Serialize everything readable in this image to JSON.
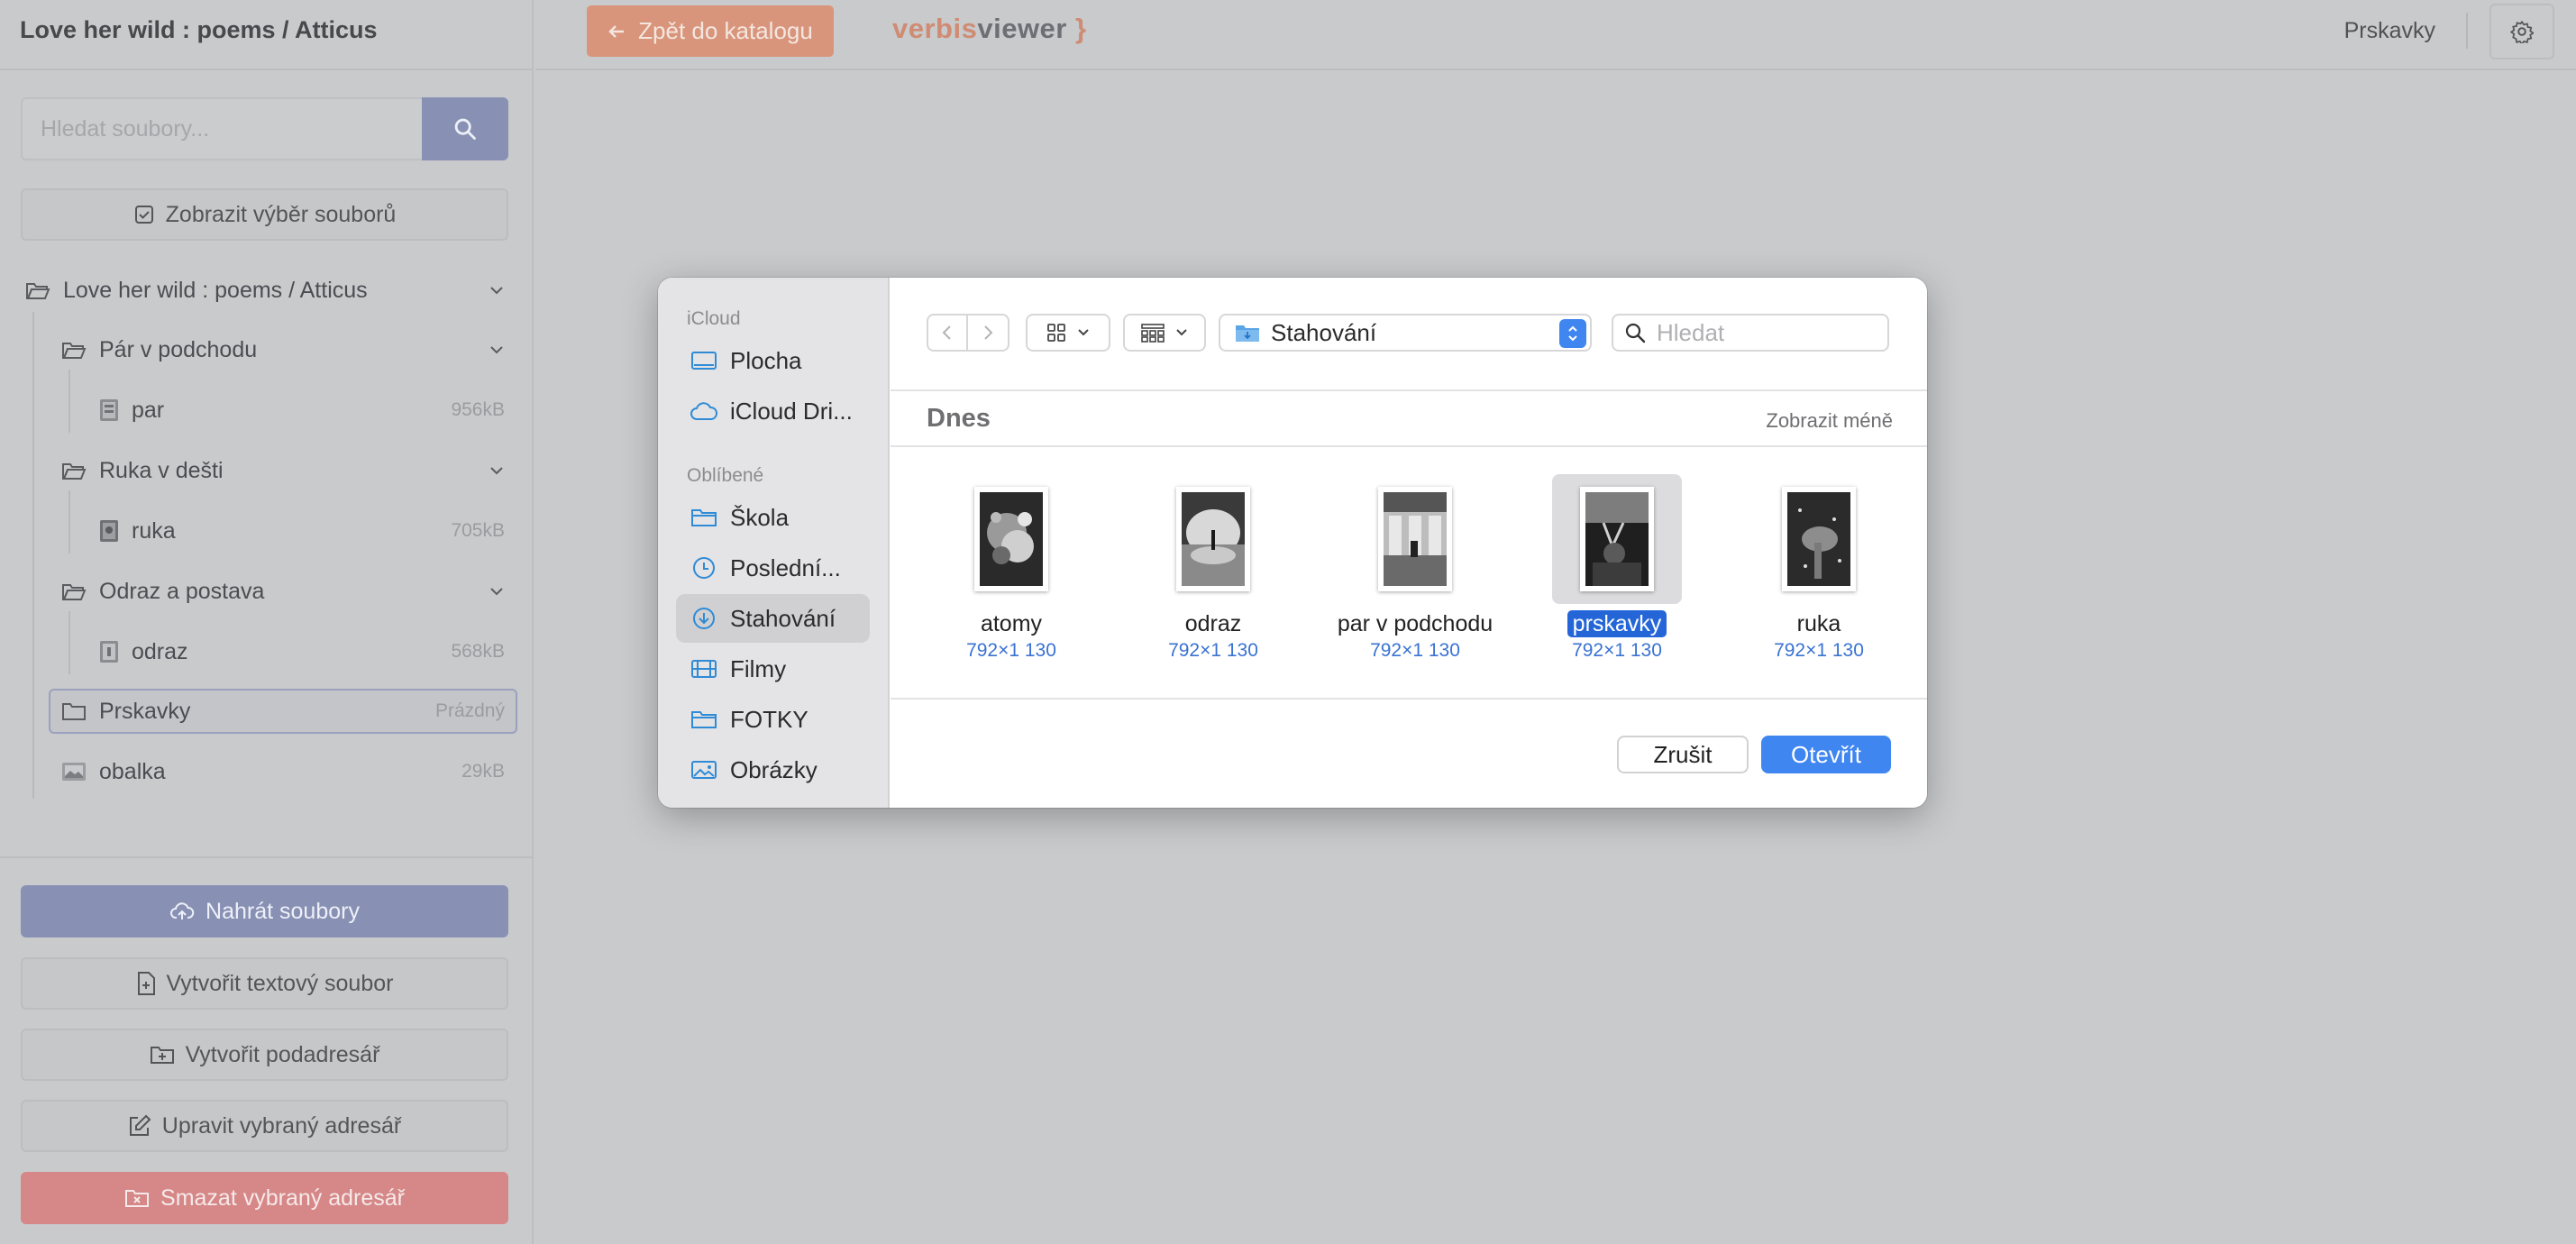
{
  "app": {
    "project_title": "Love her wild : poems / Atticus",
    "back_button": "Zpět do katalogu",
    "logo": {
      "part1": "verbis",
      "part2": "viewer",
      "part3": "}"
    },
    "user": "Prskavky",
    "icons": {
      "settings": "gear-icon",
      "back": "arrow-left-icon"
    }
  },
  "sidebar": {
    "search": {
      "placeholder": "Hledat soubory..."
    },
    "show_selection": "Zobrazit výběr souborů",
    "tree": {
      "root": "Love her wild : poems / Atticus",
      "folders": [
        {
          "label": "Pár v podchodu",
          "file": {
            "name": "par",
            "size": "956kB"
          }
        },
        {
          "label": "Ruka v dešti",
          "file": {
            "name": "ruka",
            "size": "705kB"
          }
        },
        {
          "label": "Odraz a postava",
          "file": {
            "name": "odraz",
            "size": "568kB"
          }
        }
      ],
      "empty_folder": {
        "label": "Prskavky",
        "badge": "Prázdný"
      },
      "cover": {
        "name": "obalka",
        "size": "29kB"
      }
    },
    "actions": {
      "upload": "Nahrát soubory",
      "create_text": "Vytvořit textový soubor",
      "create_subdir": "Vytvořit podadresář",
      "edit_dir": "Upravit vybraný adresář",
      "delete_dir": "Smazat vybraný adresář"
    }
  },
  "dialog": {
    "sidebar": {
      "icloud_heading": "iCloud",
      "icloud_items": [
        "Plocha",
        "iCloud Dri..."
      ],
      "favorites_heading": "Oblíbené",
      "favorite_items": [
        "Škola",
        "Poslední...",
        "Stahování",
        "Filmy",
        "FOTKY",
        "Obrázky"
      ],
      "selected": "Stahování"
    },
    "location": "Stahování",
    "search_placeholder": "Hledat",
    "group_title": "Dnes",
    "show_less": "Zobrazit méně",
    "files": [
      {
        "name": "atomy",
        "dims": "792×1 130"
      },
      {
        "name": "odraz",
        "dims": "792×1 130"
      },
      {
        "name": "par v podchodu",
        "dims": "792×1 130"
      },
      {
        "name": "prskavky",
        "dims": "792×1 130"
      },
      {
        "name": "ruka",
        "dims": "792×1 130"
      }
    ],
    "selected_file": "prskavky",
    "cancel": "Zrušit",
    "open": "Otevřít",
    "accent_color": "#3f86f0"
  }
}
